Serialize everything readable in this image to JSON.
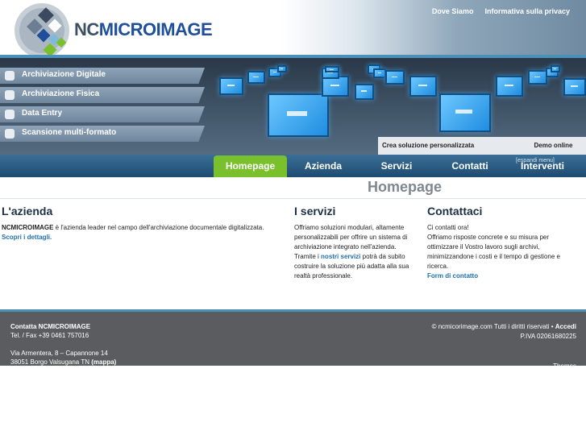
{
  "header": {
    "logo_nc": "NC",
    "logo_micro": "MICROIMAGE",
    "links": [
      "Dove Siamo",
      "Informativa sulla privacy"
    ]
  },
  "left_menu": [
    "Archiviazione Digitale",
    "Archiviazione Fisica",
    "Data Entry",
    "Scansione multi-formato"
  ],
  "banner_buttons": {
    "crea": "Crea soluzione personalizzata",
    "demo": "Demo online"
  },
  "nav": {
    "tabs": [
      "Homepage",
      "Azienda",
      "Servizi",
      "Contatti",
      "Interventi"
    ],
    "active": "Homepage",
    "expand_text": "[espandi menu]"
  },
  "page_title": "Homepage",
  "azienda": {
    "heading": "L'azienda",
    "company": "NCMICROIMAGE",
    "text": " è l'azienda leader nel campo dell'archiviazione documentale digitalizzata.",
    "link": "Scopri i dettagli."
  },
  "servizi": {
    "heading": "I servizi",
    "text1": "Offriamo soluzioni modulari, altamente personalizzabili per offrire un sistema di archiviazione integrato nell'azienda.",
    "text2_pre": "Tramite i ",
    "link": "nostri servizi",
    "text2_post": " potrà da subito costruire la soluzione più adatta alla sua realtà professionale."
  },
  "contattaci": {
    "heading": "Contattaci",
    "line1": "Ci contatti ora!",
    "text": "Offriamo risposte concrete e su misura per ottimizzare il Vostro lavoro sugli archivi, minimizzandone i costi e il tempo di gestione e ricerca.",
    "link": "Form di contatto"
  },
  "footer": {
    "title": "Contatta NCMICROIMAGE",
    "tel": "Tel. / Fax +39 0461 757016",
    "addr1": "Via Armentera, 8 – Capannone 14",
    "addr2": "38051 Borgo Valsugana TN",
    "map": "(mappa)",
    "copyright": "© ncmicorimage.com Tutti i diritti riservati •",
    "accedi": "Accedi",
    "piva": "P.IVA 02061680225",
    "cut": "Themes"
  },
  "colors": {
    "nav_active": "#7ac02c",
    "nav_bg": "#1e4b70",
    "link": "#1f6fae",
    "footer_bg": "#5a5c5f"
  }
}
